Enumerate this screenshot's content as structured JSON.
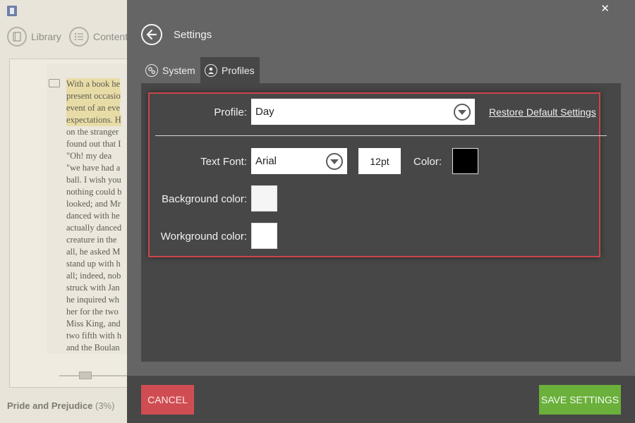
{
  "reader": {
    "nav": {
      "library_label": "Library",
      "contents_label": "Content"
    },
    "book_lines_highlighted": [
      "With a book he",
      "present occasio",
      "event of an eve",
      "expectations. H"
    ],
    "book_lines": [
      "on the stranger",
      "found out that I",
      "    \"Oh! my dea",
      "\"we have had a",
      "ball. I wish you",
      "nothing could b",
      "looked; and Mr",
      "danced with he",
      "actually danced",
      "creature in the",
      "all, he asked M",
      "stand up with h",
      "all; indeed, nob",
      "struck with Jan",
      "he inquired wh",
      "her for the two",
      "Miss King, and",
      "two fifth with h",
      "and the Boulan"
    ],
    "book_title": "Pride and Prejudice",
    "book_progress": "(3%)"
  },
  "settings": {
    "title": "Settings",
    "close_glyph": "✕",
    "tabs": [
      {
        "label": "System",
        "active": false
      },
      {
        "label": "Profiles",
        "active": true
      }
    ],
    "profile": {
      "label": "Profile:",
      "value": "Day",
      "restore_label": "Restore Default Settings"
    },
    "text_font": {
      "label": "Text Font:",
      "value": "Arial",
      "size": "12pt",
      "color_label": "Color:",
      "color": "#000000"
    },
    "background_color": {
      "label": "Background color:",
      "color": "#f5f5f5"
    },
    "workground_color": {
      "label": "Workground color:",
      "color": "#ffffff"
    },
    "footer": {
      "cancel_label": "CANCEL",
      "save_label": "SAVE SETTINGS"
    }
  },
  "colors": {
    "accent_red": "#cf4d52",
    "accent_green": "#6ab03b",
    "highlight_outline": "#cc454b"
  }
}
